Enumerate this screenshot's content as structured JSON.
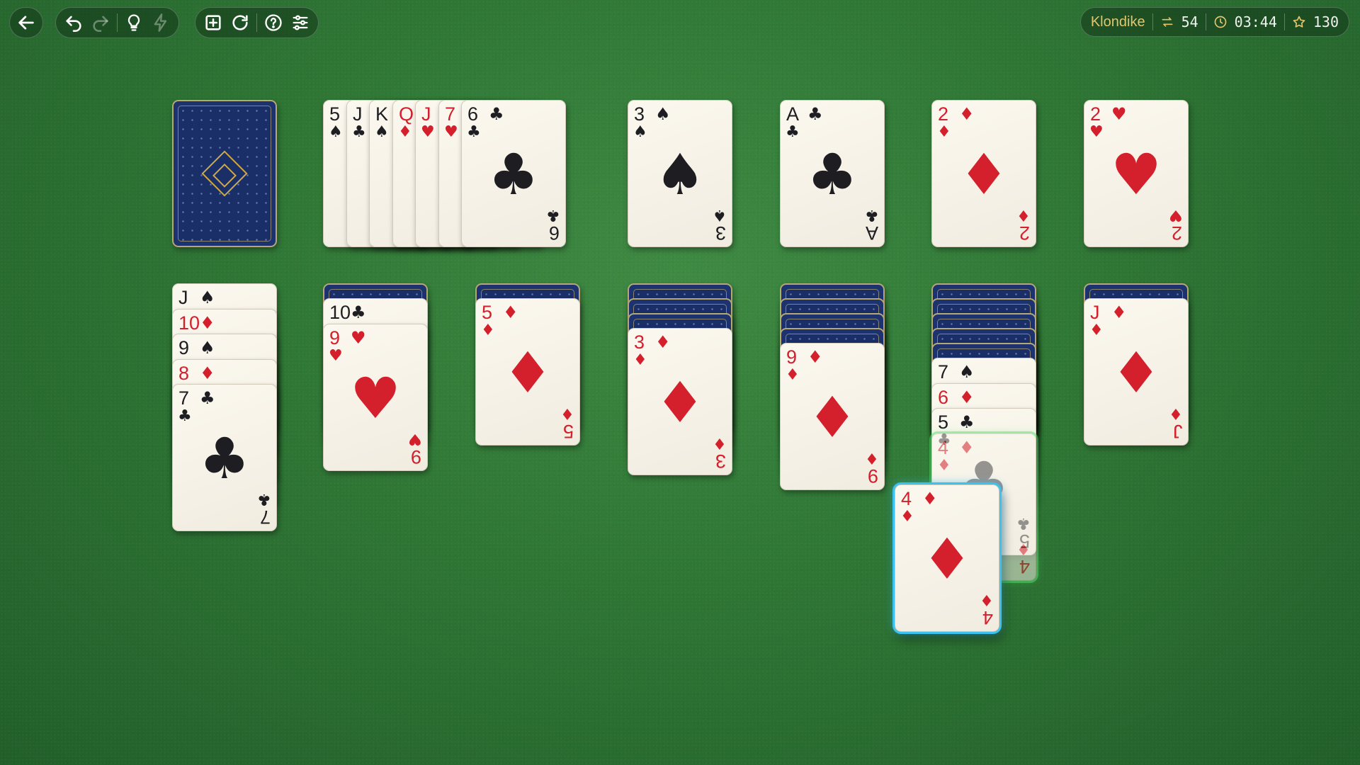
{
  "toolbar": {
    "buttons": [
      {
        "name": "back-button",
        "icon": "arrow-left-icon"
      },
      {
        "name": "undo-button",
        "icon": "undo-icon"
      },
      {
        "name": "redo-button",
        "icon": "redo-icon",
        "disabled": true
      },
      {
        "name": "hint-button",
        "icon": "lightbulb-icon"
      },
      {
        "name": "auto-button",
        "icon": "lightning-icon",
        "disabled": true
      },
      {
        "name": "new-game-button",
        "icon": "plus-square-icon"
      },
      {
        "name": "restart-button",
        "icon": "refresh-icon"
      },
      {
        "name": "help-button",
        "icon": "question-icon"
      },
      {
        "name": "settings-button",
        "icon": "sliders-icon"
      }
    ]
  },
  "status": {
    "mode": "Klondike",
    "moves": "54",
    "time": "03:44",
    "score": "130"
  },
  "colors": {
    "felt": "#2f7635",
    "red_suit": "#d4202c",
    "black_suit": "#1d1d22",
    "highlight_green": "#55e06b",
    "highlight_blue": "#3bc2f0"
  },
  "stock": {
    "face_down": true
  },
  "waste": [
    {
      "rank": "5",
      "suit": "♠"
    },
    {
      "rank": "J",
      "suit": "♣"
    },
    {
      "rank": "K",
      "suit": "♠"
    },
    {
      "rank": "Q",
      "suit": "♦"
    },
    {
      "rank": "J",
      "suit": "♥"
    },
    {
      "rank": "7",
      "suit": "♥"
    },
    {
      "rank": "6",
      "suit": "♣"
    }
  ],
  "foundations": [
    {
      "rank": "3",
      "suit": "♠"
    },
    {
      "rank": "A",
      "suit": "♣"
    },
    {
      "rank": "2",
      "suit": "♦"
    },
    {
      "rank": "2",
      "suit": "♥"
    }
  ],
  "tableau": [
    {
      "face_down": 0,
      "cards": [
        {
          "rank": "J",
          "suit": "♠"
        },
        {
          "rank": "10",
          "suit": "♦"
        },
        {
          "rank": "9",
          "suit": "♠"
        },
        {
          "rank": "8",
          "suit": "♦"
        },
        {
          "rank": "7",
          "suit": "♣"
        }
      ]
    },
    {
      "face_down": 1,
      "cards": [
        {
          "rank": "10",
          "suit": "♣"
        },
        {
          "rank": "9",
          "suit": "♥"
        }
      ]
    },
    {
      "face_down": 1,
      "cards": [
        {
          "rank": "5",
          "suit": "♦"
        }
      ]
    },
    {
      "face_down": 3,
      "cards": [
        {
          "rank": "3",
          "suit": "♦"
        }
      ]
    },
    {
      "face_down": 4,
      "cards": [
        {
          "rank": "9",
          "suit": "♦"
        }
      ]
    },
    {
      "face_down": 5,
      "cards": [
        {
          "rank": "7",
          "suit": "♠"
        },
        {
          "rank": "6",
          "suit": "♦"
        },
        {
          "rank": "5",
          "suit": "♣"
        },
        {
          "rank": "4",
          "suit": "♦",
          "ghost": true
        }
      ]
    },
    {
      "face_down": 1,
      "cards": [
        {
          "rank": "J",
          "suit": "♦"
        }
      ]
    }
  ],
  "dragging": {
    "rank": "4",
    "suit": "♦"
  }
}
